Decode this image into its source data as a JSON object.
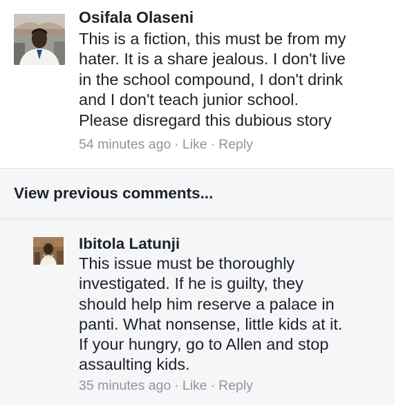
{
  "comments": [
    {
      "author": "Osifala Olaseni",
      "lines": [
        "This is a fiction, this must be from my",
        "hater. It is a share jealous. I don't live",
        "in the school compound, I don't drink",
        "and I don't teach junior school.",
        "Please disregard this dubious story"
      ],
      "time": "54 minutes ago",
      "like_label": "Like",
      "reply_label": "Reply",
      "separator": "·"
    },
    {
      "author": "Ibitola Latunji",
      "lines": [
        "This issue must be thoroughly",
        "investigated. If he is guilty,  they",
        "should help him reserve a palace in",
        "panti. What nonsense, little kids at it.",
        "If your hungry,  go to Allen and stop",
        "assaulting kids."
      ],
      "time": "35 minutes ago",
      "like_label": "Like",
      "reply_label": "Reply",
      "separator": "·"
    }
  ],
  "view_previous_label": "View previous comments...",
  "colors": {
    "text": "#1d2129",
    "meta": "#90949c",
    "reply_bg": "#f5f6f7",
    "divider": "#dddfe2"
  }
}
